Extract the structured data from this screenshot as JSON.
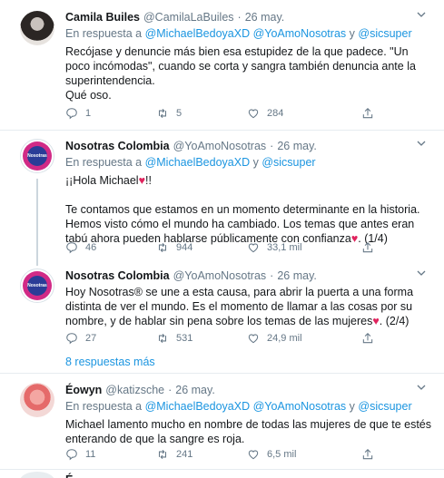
{
  "tweets": [
    {
      "name": "Camila Builes",
      "handle": "@CamilaLaBuiles",
      "sep": "·",
      "date": "26 may.",
      "reply_prefix": "En respuesta a",
      "reply_m1": "@MichaelBedoyaXD",
      "reply_m2": "@YoAmoNosotras",
      "reply_and": "y",
      "reply_m3": "@sicsuper",
      "body_line1": "Recójase y denuncie más bien esa estupidez de la que padece. \"Un poco incómodas\", cuando se corta y sangra también denuncia ante la superintendencia.",
      "body_line2": "Qué oso.",
      "replies": "1",
      "retweets": "5",
      "likes": "284"
    },
    {
      "name": "Nosotras Colombia",
      "handle": "@YoAmoNosotras",
      "sep": "·",
      "date": "26 may.",
      "reply_prefix": "En respuesta a",
      "reply_m1": "@MichaelBedoyaXD",
      "reply_and": "y",
      "reply_m2": "@sicsuper",
      "body_line1": "¡¡Hola Michael",
      "body_line1_end": "!!",
      "body_line2": "Te contamos que estamos en un momento determinante en la historia. Hemos visto cómo el mundo ha cambiado. Los temas que antes eran tabú ahora pueden hablarse públicamente con confianza",
      "body_line2_end": ". (1/4)",
      "replies": "46",
      "retweets": "944",
      "likes": "33,1 mil",
      "avatar_text": "Nosotras"
    },
    {
      "name": "Nosotras Colombia",
      "handle": "@YoAmoNosotras",
      "sep": "·",
      "date": "26 may.",
      "body_line1": "Hoy Nosotras® se une a esta causa, para abrir la puerta a una forma distinta de ver el mundo. Es el momento de llamar a las cosas por su nombre, y de hablar sin pena sobre los temas de las mujeres",
      "body_line1_end": ". (2/4)",
      "replies": "27",
      "retweets": "531",
      "likes": "24,9 mil",
      "avatar_text": "Nosotras"
    },
    {
      "name": "Éowyn",
      "handle": "@katizsche",
      "sep": "·",
      "date": "26 may.",
      "reply_prefix": "En respuesta a",
      "reply_m1": "@MichaelBedoyaXD",
      "reply_m2": "@YoAmoNosotras",
      "reply_and": "y",
      "reply_m3": "@sicsuper",
      "body_line1": "Michael lamento mucho en nombre de todas las mujeres de que te estés enterando de que la sangre es roja.",
      "replies": "11",
      "retweets": "241",
      "likes": "6,5 mil"
    }
  ],
  "more_replies_label": "8 respuestas más",
  "stub_name": "É",
  "icons": {
    "reply": "reply-icon",
    "retweet": "retweet-icon",
    "like": "heart-icon",
    "share": "share-icon",
    "caret": "chevron-down-icon",
    "emoji_heart": "red-heart-emoji"
  },
  "colors": {
    "link": "#1b95e0",
    "muted": "#657786",
    "heart": "#e0245e",
    "border": "#e6ecf0"
  }
}
